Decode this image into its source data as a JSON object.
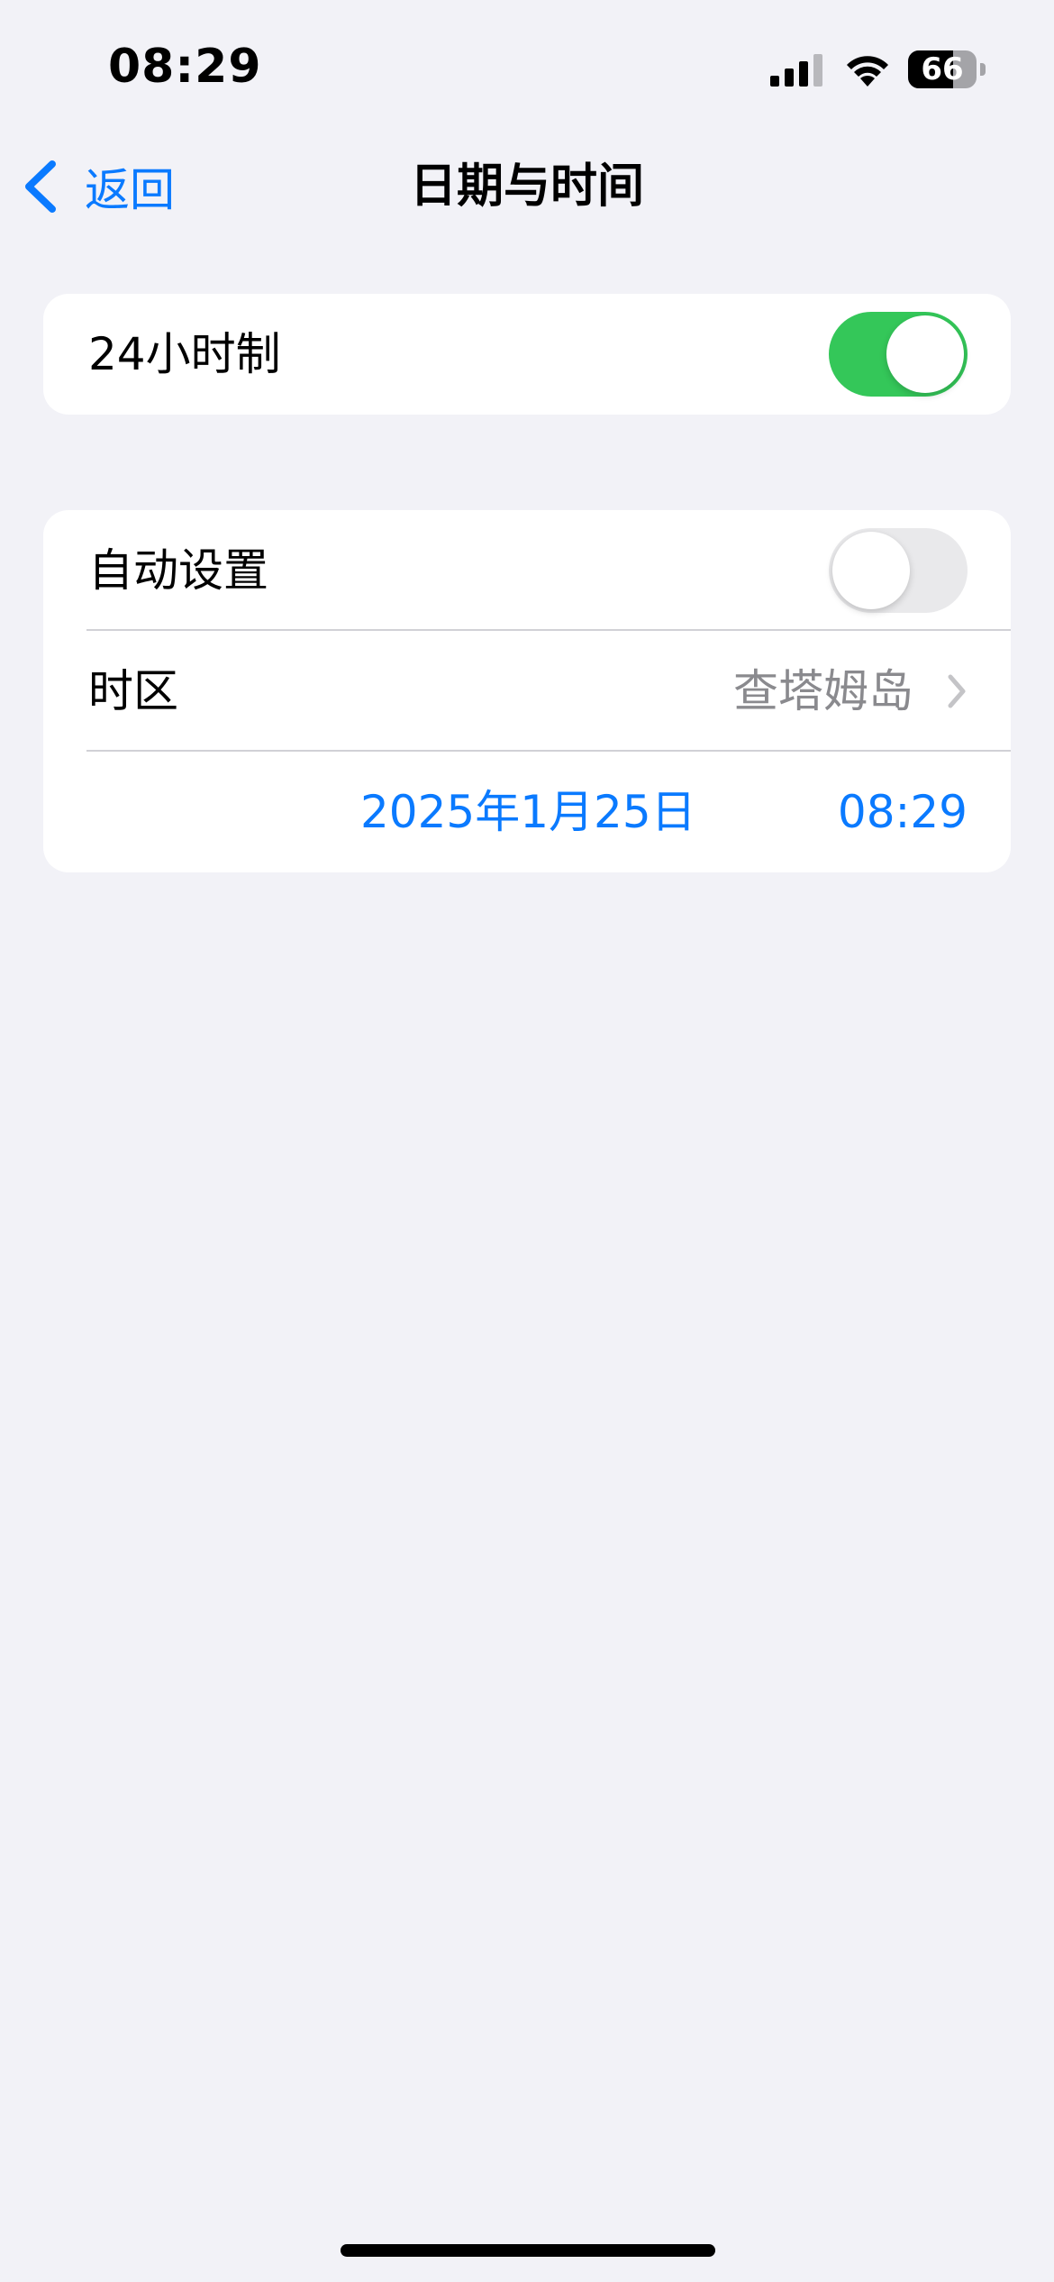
{
  "status_bar": {
    "time": "08:29",
    "battery_level": "66",
    "battery_fraction": 0.66,
    "signal_icon": "cellular-signal-icon",
    "wifi_icon": "wifi-icon"
  },
  "nav": {
    "back_label": "返回",
    "title": "日期与时间",
    "back_icon": "chevron-left-icon"
  },
  "group1": {
    "hour24_label": "24小时制",
    "hour24_on": true
  },
  "group2": {
    "auto_label": "自动设置",
    "auto_on": false,
    "timezone_label": "时区",
    "timezone_value": "查塔姆岛",
    "date_value": "2025年1月25日",
    "time_value": "08:29"
  },
  "colors": {
    "accent": "#0a7aff",
    "toggle_on": "#34c759",
    "toggle_off": "#e9e9eb",
    "background": "#f2f2f7"
  }
}
